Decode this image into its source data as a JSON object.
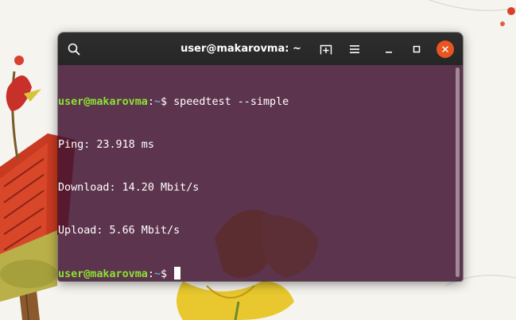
{
  "window": {
    "title": "user@makarovma: ~"
  },
  "terminal": {
    "lines": [
      {
        "user": "user@makarovma",
        "sep": ":",
        "path": "~",
        "symbol": "$ ",
        "command": "speedtest --simple"
      },
      {
        "output": "Ping: 23.918 ms"
      },
      {
        "output": "Download: 14.20 Mbit/s"
      },
      {
        "output": "Upload: 5.66 Mbit/s"
      },
      {
        "user": "user@makarovma",
        "sep": ":",
        "path": "~",
        "symbol": "$ ",
        "command": ""
      }
    ]
  },
  "icons": {
    "search": "search-icon",
    "new_tab": "new-tab-icon",
    "menu": "hamburger-menu-icon",
    "minimize": "minimize-icon",
    "maximize": "maximize-icon",
    "close": "close-icon"
  },
  "colors": {
    "terminal_background": "#441432",
    "titlebar": "#2c2c2c",
    "prompt_user": "#8ae234",
    "prompt_path": "#729fcf",
    "close_button": "#e95420"
  }
}
